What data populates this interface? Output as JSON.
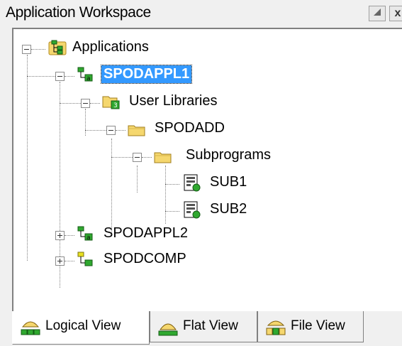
{
  "window": {
    "title": "Application Workspace",
    "maximize_glyph": "▲",
    "close_glyph": "x"
  },
  "tree": {
    "nodes": [
      {
        "label": "Applications",
        "icon": "applications-icon",
        "expander": "minus"
      },
      {
        "label": "SPODAPPL1",
        "icon": "application-icon",
        "expander": "minus",
        "selected": true
      },
      {
        "label": "User Libraries",
        "icon": "user-libraries-folder-icon",
        "expander": "minus"
      },
      {
        "label": "SPODADD",
        "icon": "library-folder-icon",
        "expander": "minus"
      },
      {
        "label": "Subprograms",
        "icon": "subprograms-folder-icon",
        "expander": "minus"
      },
      {
        "label": "SUB1",
        "icon": "subprogram-object-icon",
        "expander": "none"
      },
      {
        "label": "SUB2",
        "icon": "subprogram-object-icon",
        "expander": "none"
      },
      {
        "label": "SPODAPPL2",
        "icon": "application-icon",
        "expander": "plus"
      },
      {
        "label": "SPODCOMP",
        "icon": "compound-application-icon",
        "expander": "plus"
      }
    ]
  },
  "tabs": [
    {
      "label": "Logical View",
      "icon": "logical-view-icon",
      "active": true
    },
    {
      "label": "Flat View",
      "icon": "flat-view-icon",
      "active": false
    },
    {
      "label": "File View",
      "icon": "file-view-icon",
      "active": false
    }
  ],
  "colors": {
    "selection": "#3399ff",
    "folder": "#f5d76e",
    "app_green": "#2fa82f"
  }
}
